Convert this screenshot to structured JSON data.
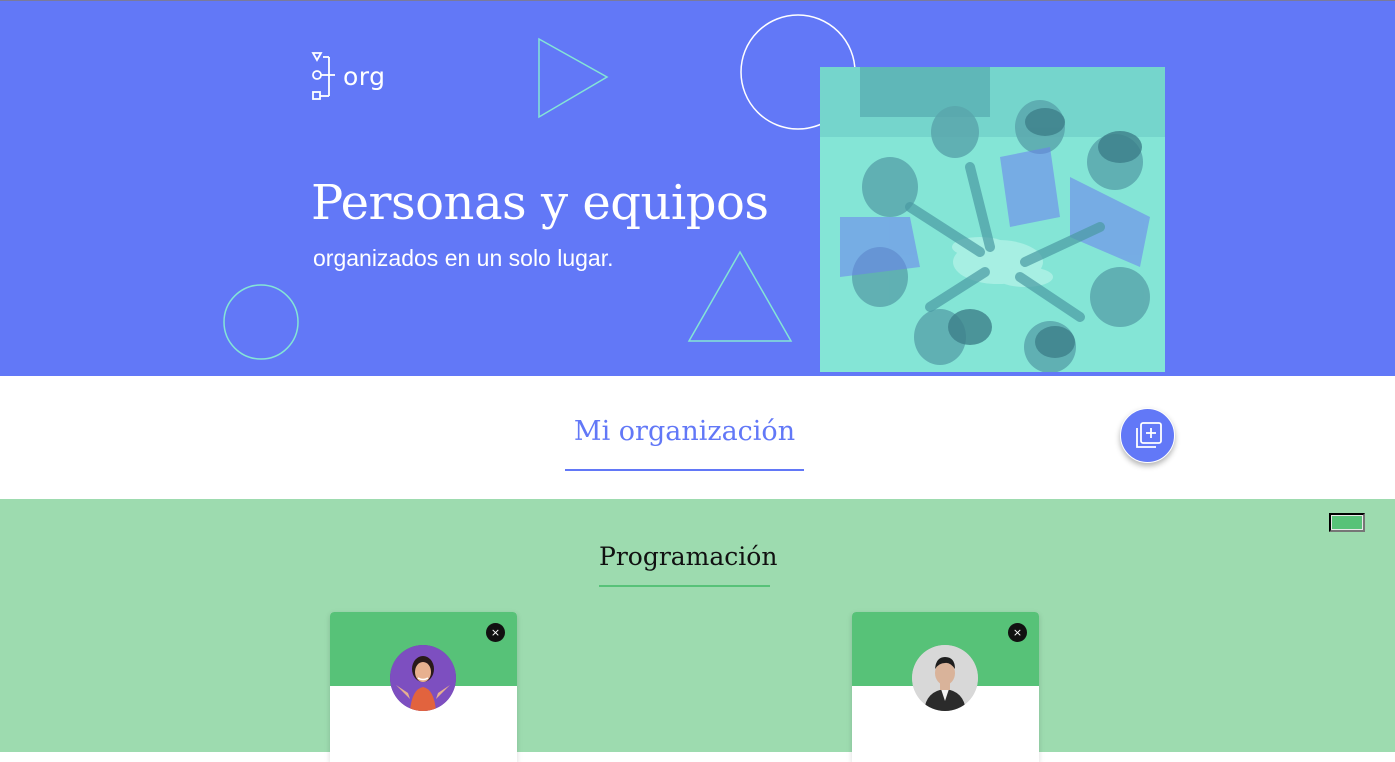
{
  "header": {
    "logo_text": "org",
    "title": "Personas y equipos",
    "subtitle": "organizados en un solo lugar."
  },
  "organization": {
    "title": "Mi organización",
    "add_button_icon": "add-copy-icon"
  },
  "teams": [
    {
      "title": "Programación",
      "primary_color": "#57c278",
      "secondary_color": "#9ddbaf",
      "members": [
        {
          "delete_label": "×",
          "avatar_icon": "woman-avatar"
        },
        {
          "delete_label": "×",
          "avatar_icon": "man-avatar"
        }
      ]
    }
  ],
  "colors": {
    "hero_background": "#6278f7",
    "accent": "#6278f7",
    "decoration_stroke": "#84e5d6"
  }
}
